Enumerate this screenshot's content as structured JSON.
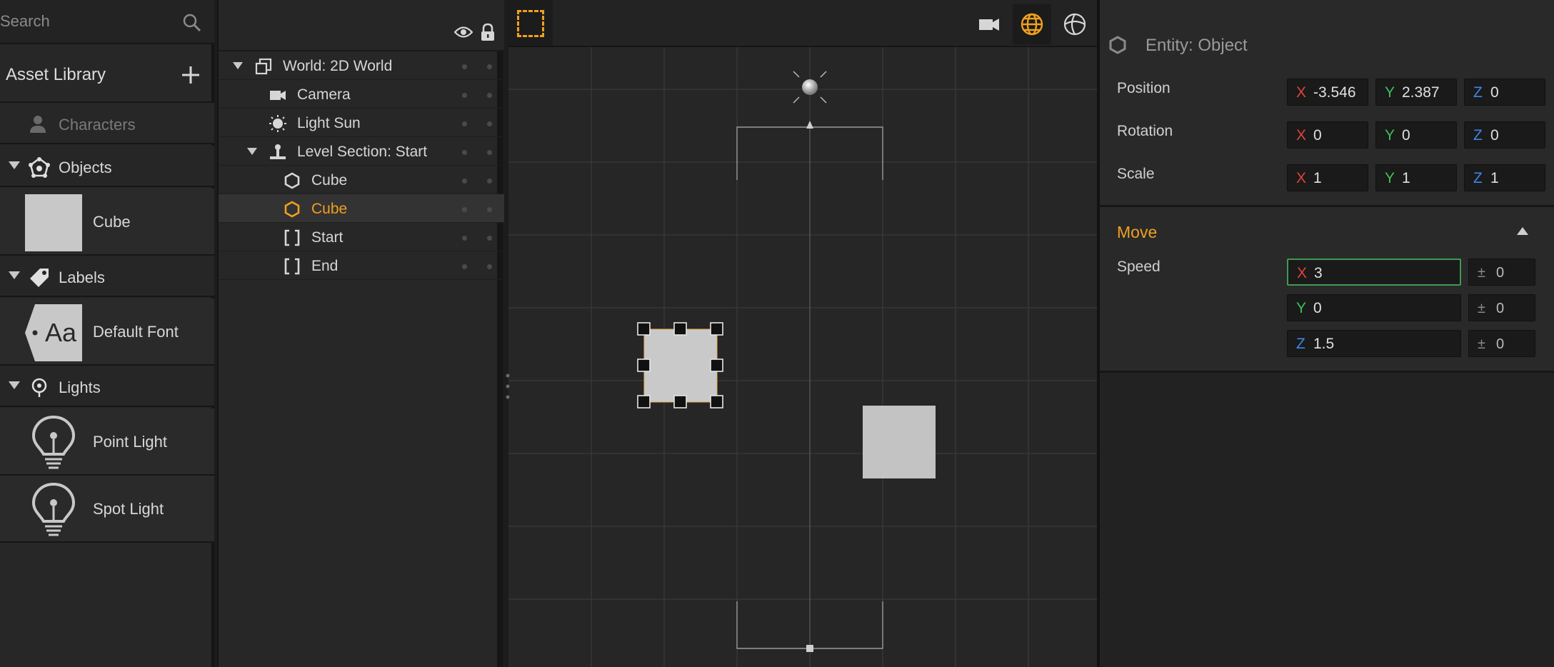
{
  "assets": {
    "search_placeholder": "Search",
    "library_title": "Asset Library",
    "characters_label": "Characters",
    "categories": [
      {
        "label": "Objects",
        "icon": "objects-icon",
        "items": [
          {
            "label": "Cube",
            "icon": "cube-thumbnail"
          }
        ]
      },
      {
        "label": "Labels",
        "icon": "tag-icon",
        "items": [
          {
            "label": "Default Font",
            "icon": "font-tag-thumbnail",
            "glyph": "Aa"
          }
        ]
      },
      {
        "label": "Lights",
        "icon": "light-icon",
        "items": [
          {
            "label": "Point Light",
            "icon": "bulb-icon"
          },
          {
            "label": "Spot Light",
            "icon": "bulb-icon"
          }
        ]
      }
    ]
  },
  "outliner": {
    "rows": [
      {
        "label": "World: 2D World",
        "icon": "world-icon",
        "expanded": true
      },
      {
        "label": "Camera",
        "icon": "camera-icon"
      },
      {
        "label": "Light Sun",
        "icon": "sun-icon"
      },
      {
        "label": "Level Section: Start",
        "icon": "level-section-icon",
        "expanded": true
      },
      {
        "label": "Cube",
        "icon": "hexagon-icon"
      },
      {
        "label": "Cube",
        "icon": "hexagon-icon",
        "selected": true
      },
      {
        "label": "Start",
        "icon": "brackets-icon"
      },
      {
        "label": "End",
        "icon": "brackets-icon"
      }
    ]
  },
  "viewport": {
    "tools": [
      "marquee-select-icon",
      "camera-view-icon",
      "world-view-icon",
      "globe-icon"
    ],
    "active_tool": "world-view-icon",
    "accent": "#f0a020"
  },
  "inspector": {
    "title": "Entity: Object",
    "properties": [
      {
        "label": "Position",
        "x": "-3.546",
        "y": "2.387",
        "z": "0"
      },
      {
        "label": "Rotation",
        "x": "0",
        "y": "0",
        "z": "0"
      },
      {
        "label": "Scale",
        "x": "1",
        "y": "1",
        "z": "1"
      }
    ],
    "move": {
      "title": "Move",
      "speed_label": "Speed",
      "speed": {
        "x": "3",
        "y": "0",
        "z": "1.5"
      },
      "variance": {
        "x": "0",
        "y": "0",
        "z": "0"
      },
      "variance_symbol": "±"
    }
  },
  "axis_labels": {
    "x": "X",
    "y": "Y",
    "z": "Z"
  },
  "colors": {
    "accent": "#f0a020",
    "axis_x": "#e0443a",
    "axis_y": "#3fbf5a",
    "axis_z": "#3d86e8",
    "focus_border": "#3e9a52"
  }
}
